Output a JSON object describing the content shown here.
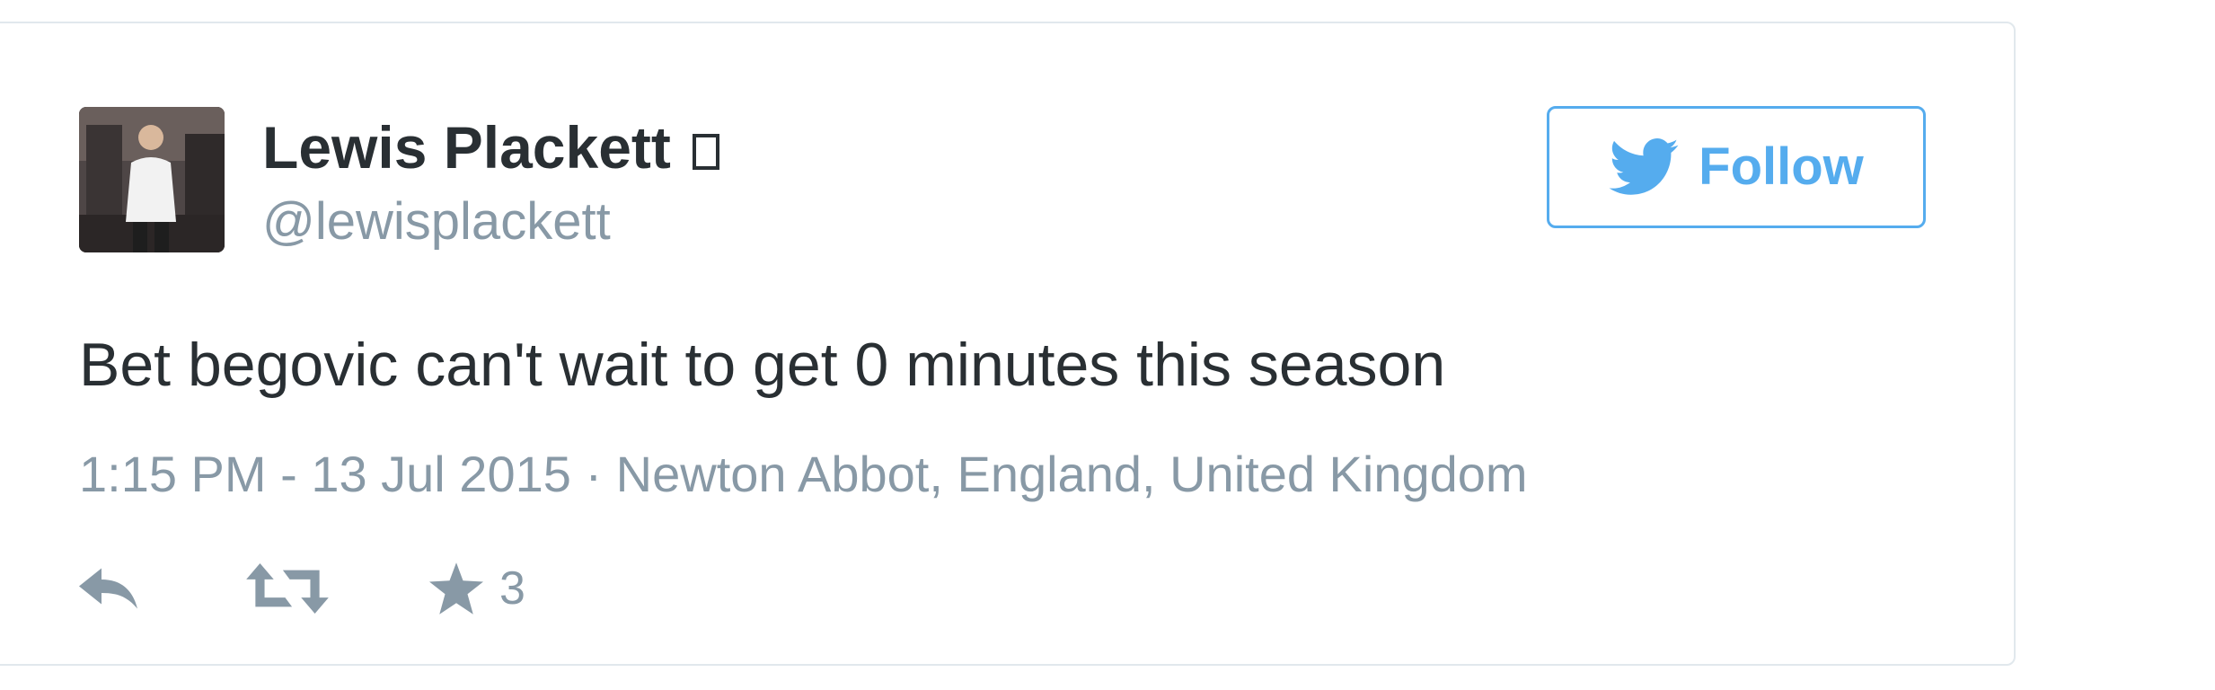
{
  "tweet": {
    "author": {
      "display_name": "Lewis Plackett",
      "verified_glyph": "missing-glyph-icon",
      "handle": "@lewisplackett",
      "avatar_icon": "profile-photo"
    },
    "follow_button": {
      "label": "Follow",
      "icon": "twitter-bird-icon",
      "color": "#55acee"
    },
    "text": "Bet begovic can't wait to get 0 minutes this season",
    "timestamp": "1:15 PM - 13 Jul 2015",
    "separator": "·",
    "location": "Newton Abbot, England, United Kingdom",
    "actions": {
      "reply_icon": "reply-icon",
      "retweet_icon": "retweet-icon",
      "favorite_icon": "star-icon",
      "favorite_count": "3"
    }
  },
  "colors": {
    "text_primary": "#292f33",
    "text_secondary": "#8899a6",
    "border": "#e1e8ed",
    "accent": "#55acee"
  }
}
